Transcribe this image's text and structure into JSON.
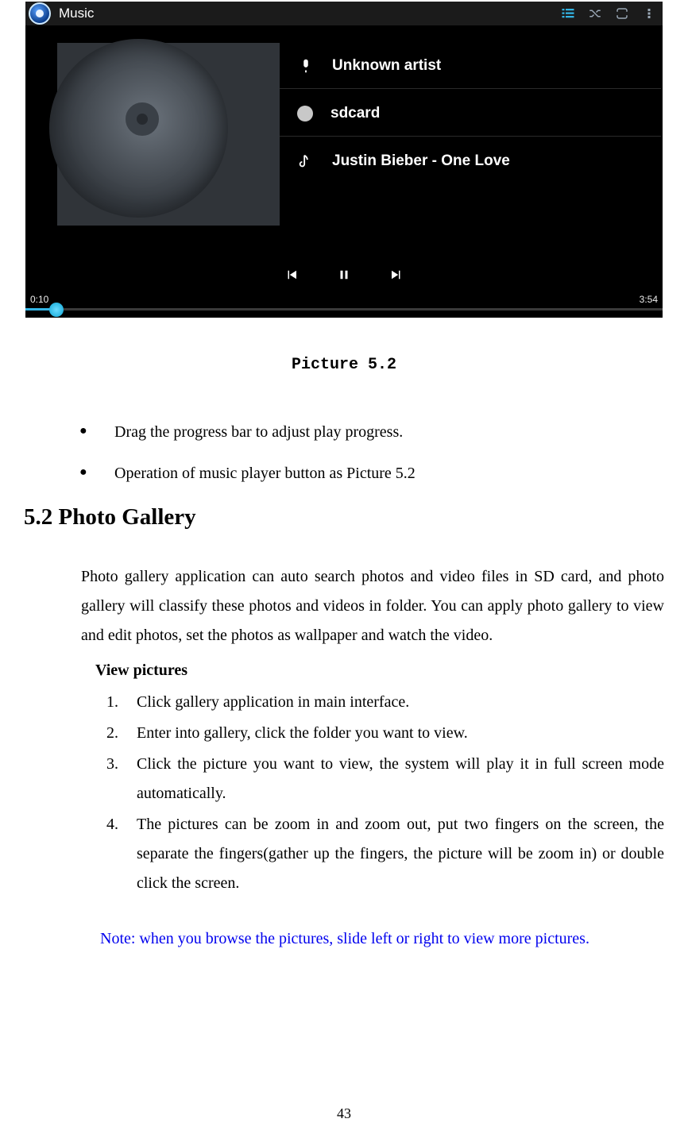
{
  "screenshot": {
    "app_title": "Music",
    "tracks": [
      {
        "label": "Unknown artist"
      },
      {
        "label": "sdcard"
      },
      {
        "label": "Justin Bieber - One Love"
      }
    ],
    "time_elapsed": "0:10",
    "time_total": "3:54"
  },
  "caption": "Picture 5.2",
  "bullets": [
    "Drag the progress bar to adjust play progress.",
    "Operation of music player button as Picture 5.2"
  ],
  "section_heading": "5.2 Photo Gallery",
  "paragraph": "Photo gallery application can auto search photos and video files in SD card, and photo gallery will classify these photos and videos in folder. You can apply photo gallery to view and edit photos, set the photos as wallpaper and watch the video.",
  "subheading": "View pictures",
  "steps": [
    "Click gallery application in main interface.",
    "Enter into gallery, click the folder you want to view.",
    "Click the picture you want to view, the system will play it in full screen mode automatically.",
    "The pictures can be zoom in and zoom out, put two fingers on the screen, the separate the fingers(gather up the fingers, the picture will be zoom in) or double click the screen."
  ],
  "note": "Note: when you browse the pictures, slide left or right to view more pictures.",
  "page_number": "43"
}
